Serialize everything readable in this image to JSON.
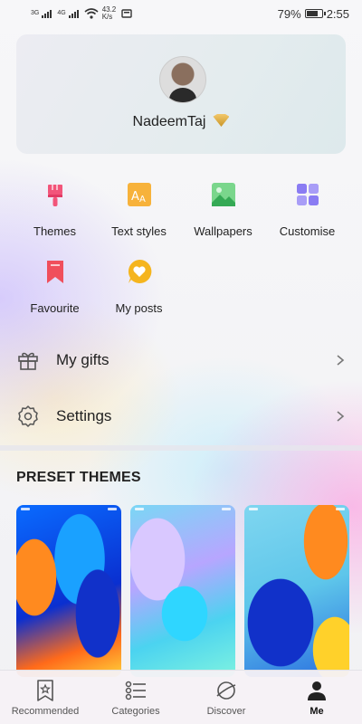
{
  "status_bar": {
    "network_1": "3G",
    "network_2": "4G",
    "speed_value": "43.2",
    "speed_unit": "K/s",
    "battery": "79%",
    "time": "2:55"
  },
  "profile": {
    "username": "NadeemTaj"
  },
  "features": [
    {
      "label": "Themes",
      "icon": "brush-icon",
      "color": "#f2557a"
    },
    {
      "label": "Text styles",
      "icon": "text-style-icon",
      "color": "#f5a623"
    },
    {
      "label": "Wallpapers",
      "icon": "image-icon",
      "color": "#45c26a"
    },
    {
      "label": "Customise",
      "icon": "grid-icon",
      "color": "#7b6cf0"
    },
    {
      "label": "Favourite",
      "icon": "bookmark-icon",
      "color": "#f04f5c"
    },
    {
      "label": "My posts",
      "icon": "heart-bubble-icon",
      "color": "#f5b51e"
    }
  ],
  "menu": {
    "gifts": "My gifts",
    "settings": "Settings"
  },
  "preset_themes": {
    "title": "PRESET THEMES"
  },
  "bottom_nav": {
    "recommended": "Recommended",
    "categories": "Categories",
    "discover": "Discover",
    "me": "Me",
    "active": "Me"
  }
}
